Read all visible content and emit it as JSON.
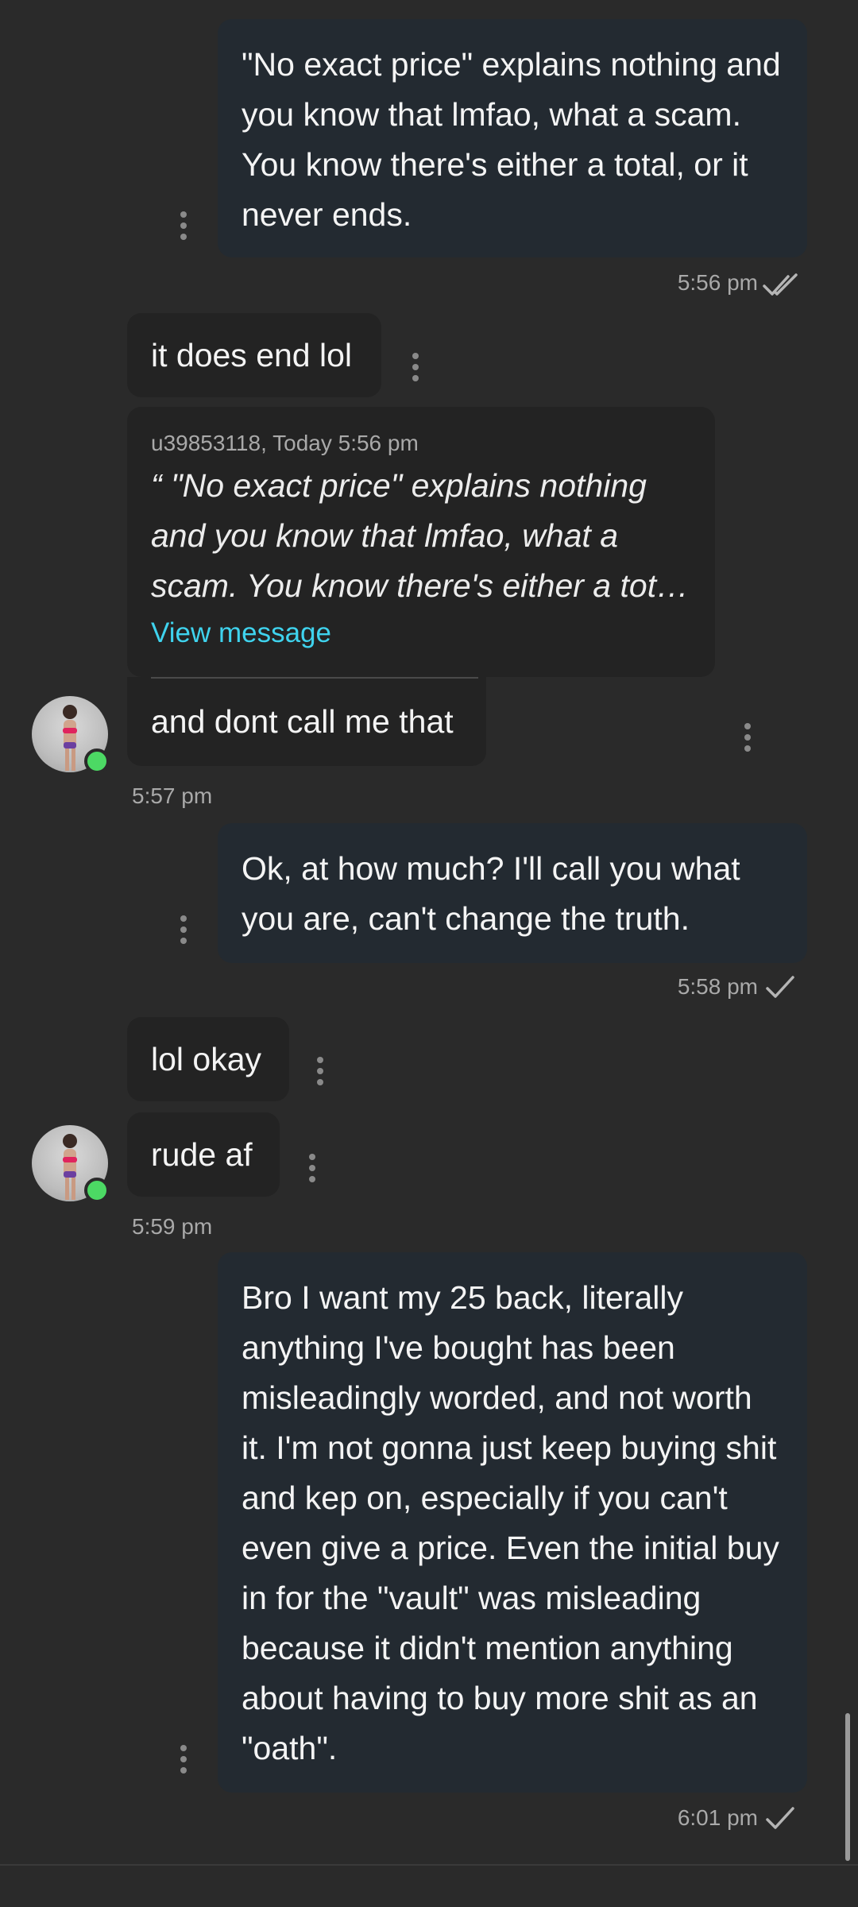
{
  "messages": {
    "out1": {
      "text": "\"No exact price\" explains nothing and you know that lmfao, what a scam. You know there's either a total, or it never ends.",
      "time": "5:56 pm",
      "status_icon": "double-check-icon"
    },
    "in1": {
      "text": "it does end lol"
    },
    "quote": {
      "meta": "u39853118, Today 5:56 pm",
      "text": "“ \"No exact price\" explains nothing and you know that lmfao, what a scam. You know there's either a tot…",
      "link": "View message"
    },
    "in2": {
      "text": "and dont call me that",
      "time": "5:57 pm"
    },
    "out2": {
      "text": "Ok, at how much? I'll call you what you are, can't change the truth.",
      "time": "5:58 pm",
      "status_icon": "check-icon"
    },
    "in3": {
      "text": "lol okay"
    },
    "in4": {
      "text": "rude af",
      "time": "5:59 pm"
    },
    "out3": {
      "text": "Bro I want my 25 back, literally anything I've bought has been misleadingly worded, and not worth it. I'm not gonna just keep buying shit and kep on, especially if you can't even give a price. Even the initial buy in for the \"vault\" was misleading because it didn't mention anything about having to buy more shit as an \"oath\".",
      "time": "6:01 pm",
      "status_icon": "check-icon"
    }
  },
  "colors": {
    "background": "#2a2a2a",
    "outgoing_bubble": "#232a31",
    "incoming_bubble": "#232323",
    "link": "#3fd3ee",
    "online": "#4cd964"
  }
}
